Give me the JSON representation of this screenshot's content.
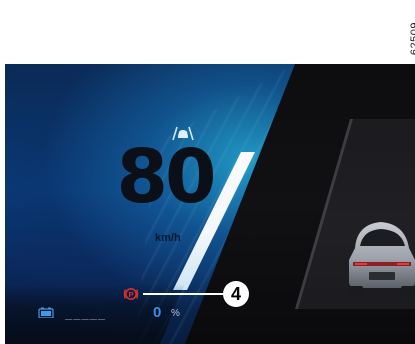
{
  "reference_code": "62509",
  "cluster": {
    "speed": {
      "value": "80",
      "unit": "km/h"
    },
    "icons": {
      "driver_assist": "lane-keeping-car-icon",
      "parking_brake": "parking-brake-warning-icon",
      "battery": "battery-icon",
      "vehicle": "vehicle-rear-view"
    },
    "battery": {
      "range_placeholder": "_____",
      "charge_value": "0",
      "charge_unit": "%"
    },
    "callout": {
      "number": "4"
    },
    "colors": {
      "gauge_blue": "#1a6fb5",
      "brake_warning_red": "#d9302c",
      "charge_blue": "#3f8be0",
      "background_dark": "#0a0a0c"
    }
  }
}
